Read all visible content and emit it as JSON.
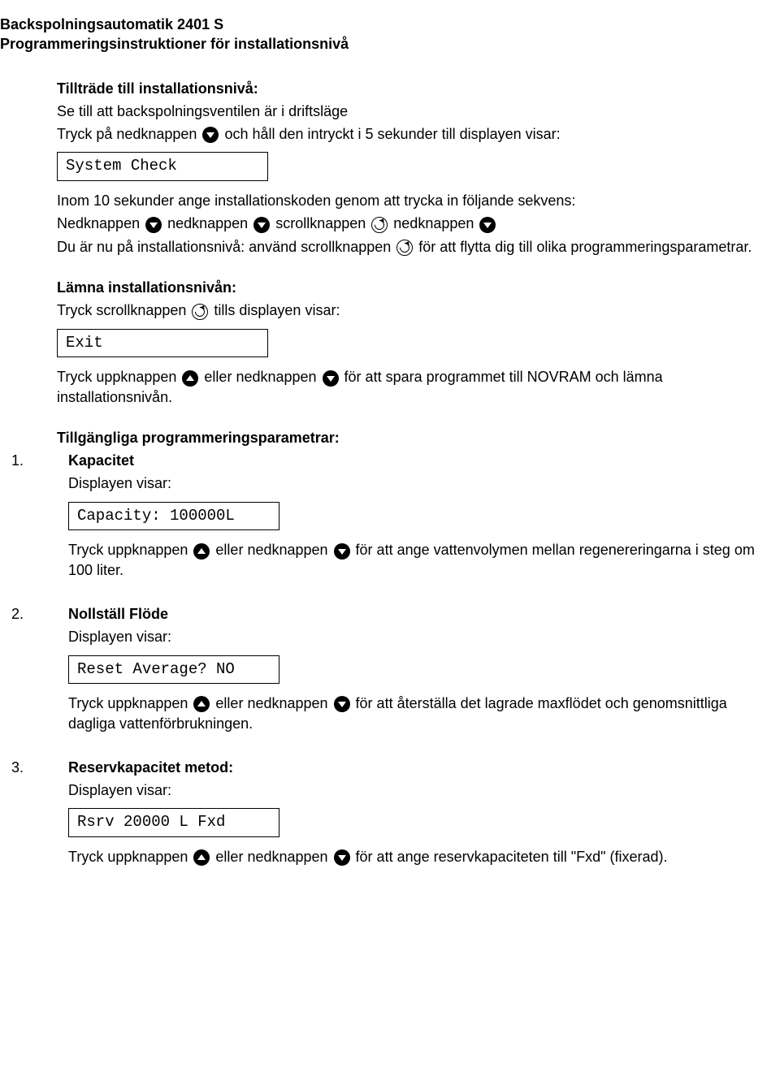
{
  "header": {
    "line1": "Backspolningsautomatik 2401 S",
    "line2": "Programmeringsinstruktioner för installationsnivå"
  },
  "access": {
    "title": "Tillträde till installationsnivå:",
    "line1": "Se till att backspolningsventilen är i driftsläge",
    "line2a": "Tryck på nedknappen ",
    "line2b": " och håll den intryckt i 5 sekunder till displayen visar:",
    "display": "System Check",
    "line3": "Inom 10 sekunder ange installationskoden genom att trycka in följande sekvens:",
    "line4a": "Nedknappen ",
    "line4b": " nedknappen ",
    "line4c": " scrollknappen ",
    "line4d": " nedknappen ",
    "line5a": "Du är nu på installationsnivå: använd scrollknappen ",
    "line5b": " för att flytta dig till olika programmeringsparametrar."
  },
  "leave": {
    "title": "Lämna installationsnivån:",
    "line1a": "Tryck scrollknappen ",
    "line1b": " tills displayen visar:",
    "display": "Exit",
    "line2a": "Tryck uppknappen ",
    "line2b": " eller nedknappen ",
    "line2c": " för att spara programmet till NOVRAM och lämna installationsnivån."
  },
  "params": {
    "title": "Tillgängliga programmeringsparametrar:"
  },
  "item1": {
    "num": "1.",
    "title": "Kapacitet",
    "line1": "Displayen visar:",
    "display": "Capacity: 100000L",
    "line2a": "Tryck uppknappen ",
    "line2b": " eller nedknappen ",
    "line2c": " för att ange vattenvolymen mellan regenereringarna i steg om 100 liter."
  },
  "item2": {
    "num": "2.",
    "title": "Nollställ Flöde",
    "line1": "Displayen visar:",
    "display": "Reset Average? NO",
    "line2a": "Tryck uppknappen ",
    "line2b": " eller nedknappen ",
    "line2c": " för att återställa det lagrade maxflödet och genomsnittliga dagliga vattenförbrukningen."
  },
  "item3": {
    "num": "3.",
    "title": "Reservkapacitet metod:",
    "line1": "Displayen visar:",
    "display": "Rsrv 20000 L Fxd",
    "line2a": "Tryck uppknappen ",
    "line2b": " eller nedknappen ",
    "line2c": " för att ange reservkapaciteten till \"Fxd\" (fixerad)."
  }
}
